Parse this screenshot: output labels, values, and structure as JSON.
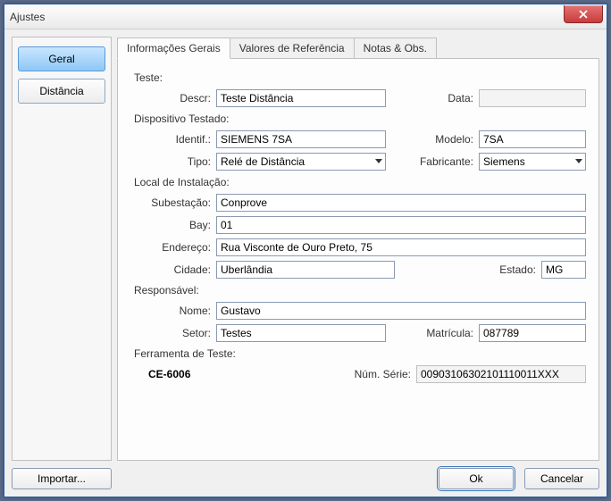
{
  "window": {
    "title": "Ajustes"
  },
  "sidebar": {
    "buttons": [
      {
        "label": "Geral",
        "active": true
      },
      {
        "label": "Distância",
        "active": false
      }
    ]
  },
  "tabs": [
    {
      "label": "Informações Gerais",
      "active": true
    },
    {
      "label": "Valores de Referência",
      "active": false
    },
    {
      "label": "Notas & Obs.",
      "active": false
    }
  ],
  "form": {
    "teste": {
      "title": "Teste:",
      "descr_label": "Descr:",
      "descr_value": "Teste Distância",
      "data_label": "Data:",
      "data_value": ""
    },
    "dispositivo": {
      "title": "Dispositivo Testado:",
      "identif_label": "Identif.:",
      "identif_value": "SIEMENS 7SA",
      "modelo_label": "Modelo:",
      "modelo_value": "7SA",
      "tipo_label": "Tipo:",
      "tipo_value": "Relé de Distância",
      "fabricante_label": "Fabricante:",
      "fabricante_value": "Siemens"
    },
    "local": {
      "title": "Local de Instalação:",
      "subestacao_label": "Subestação:",
      "subestacao_value": "Conprove",
      "bay_label": "Bay:",
      "bay_value": "01",
      "endereco_label": "Endereço:",
      "endereco_value": "Rua Visconte de Ouro Preto, 75",
      "cidade_label": "Cidade:",
      "cidade_value": "Uberlândia",
      "estado_label": "Estado:",
      "estado_value": "MG"
    },
    "responsavel": {
      "title": "Responsável:",
      "nome_label": "Nome:",
      "nome_value": "Gustavo",
      "setor_label": "Setor:",
      "setor_value": "Testes",
      "matricula_label": "Matrícula:",
      "matricula_value": "087789"
    },
    "ferramenta": {
      "title": "Ferramenta de Teste:",
      "tool": "CE-6006",
      "num_serie_label": "Núm. Série:",
      "num_serie_value": "00903106302101110011XXX"
    }
  },
  "buttons": {
    "import": "Importar...",
    "ok": "Ok",
    "cancel": "Cancelar"
  }
}
